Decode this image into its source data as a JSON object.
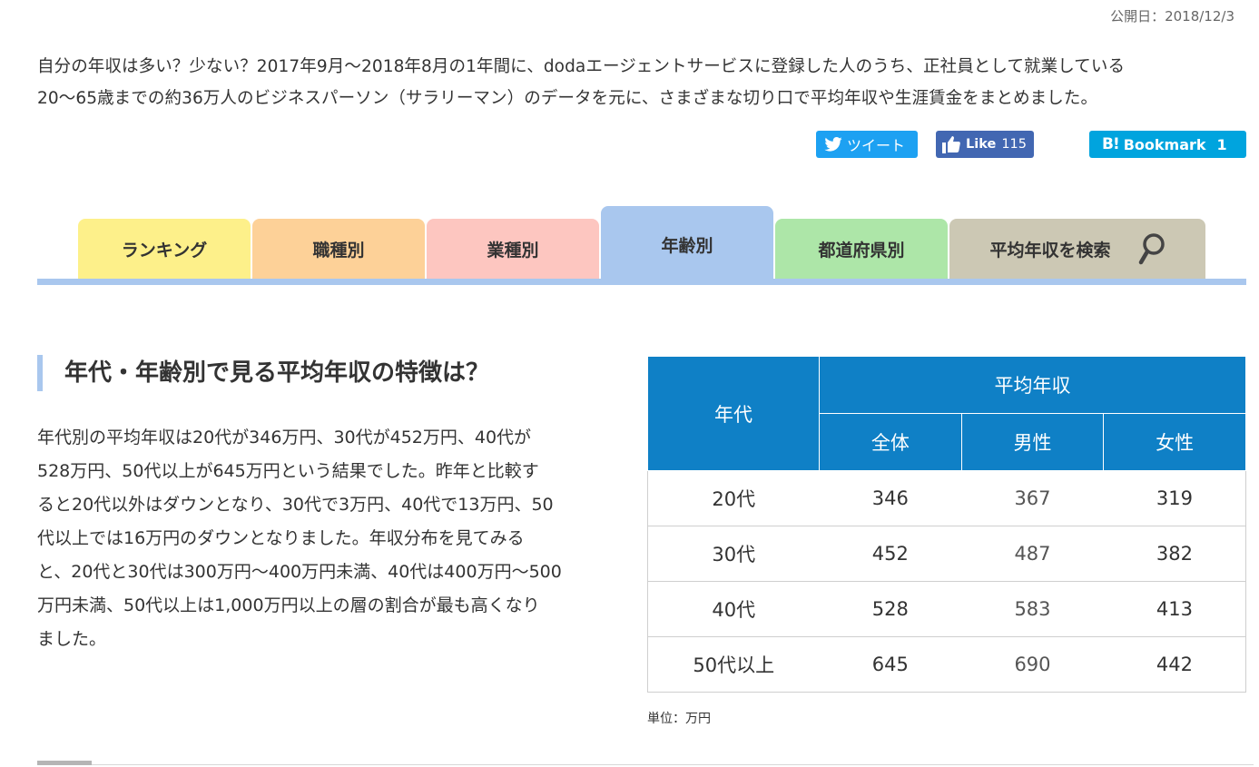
{
  "pubdate": "公開日：2018/12/3",
  "intro": {
    "line1": "自分の年収は多い？少ない？2017年9月～2018年8月の1年間に、dodaエージェントサービスに登録した人のうち、正社員として就業している",
    "line2": "20～65歳までの約36万人のビジネスパーソン（サラリーマン）のデータを元に、さまざまな切り口で平均年収や生涯賃金をまとめました。"
  },
  "share": {
    "tweet_label": "ツイート",
    "like_label": "Like",
    "like_count": "115",
    "hatena_logo": "B!",
    "bookmark_label": "Bookmark",
    "bookmark_count": "1"
  },
  "tabs": [
    {
      "label": "ランキング",
      "color": "#fdf08a"
    },
    {
      "label": "職種別",
      "color": "#fdd198"
    },
    {
      "label": "業種別",
      "color": "#fdc6c0"
    },
    {
      "label": "年齢別",
      "color": "#a9c7ee",
      "active": true
    },
    {
      "label": "都道府県別",
      "color": "#ade6a8"
    },
    {
      "label": "平均年収を検索",
      "color": "#ccc8b4",
      "icon": "magnifier-icon"
    }
  ],
  "section": {
    "title": "年代・年齢別で見る平均年収の特徴は？",
    "lines": [
      "年代別の平均年収は20代が346万円、30代が452万円、40代が",
      "528万円、50代以上が645万円という結果でした。昨年と比較す",
      "ると20代以外はダウンとなり、30代で3万円、40代で13万円、50",
      "代以上では16万円のダウンとなりました。年収分布を見てみる",
      "と、20代と30代は300万円～400万円未満、40代は400万円～500",
      "万円未満、50代以上は1,000万円以上の層の割合が最も高くなり",
      "ました。"
    ]
  },
  "table": {
    "corner": "年代",
    "group": "平均年収",
    "cols": [
      "全体",
      "男性",
      "女性"
    ],
    "rows": [
      {
        "age": "20代",
        "all": "346",
        "male": "367",
        "female": "319"
      },
      {
        "age": "30代",
        "all": "452",
        "male": "487",
        "female": "382"
      },
      {
        "age": "40代",
        "all": "528",
        "male": "583",
        "female": "413"
      },
      {
        "age": "50代以上",
        "all": "645",
        "male": "690",
        "female": "442"
      }
    ],
    "unit": "単位：万円",
    "header_color": "#0f80c6"
  }
}
